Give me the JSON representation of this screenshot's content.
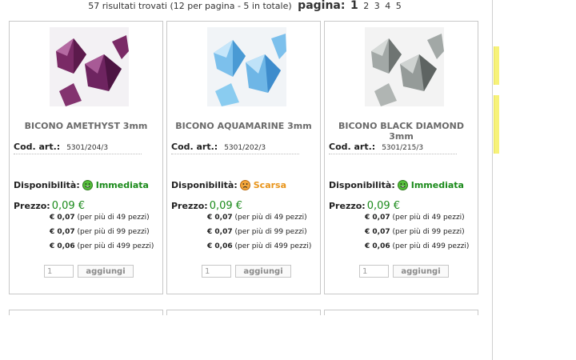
{
  "results": {
    "summary": "57 risultati trovati (12 per pagina - 5 in totale)",
    "page_label": "pagina:",
    "pages": [
      "1",
      "2",
      "3",
      "4",
      "5"
    ]
  },
  "labels": {
    "code": "Cod. art.:",
    "availability": "Disponibilità:",
    "price": "Prezzo:",
    "add_button": "aggiungi"
  },
  "products": [
    {
      "name": "BICONO AMETHYST 3mm",
      "code": "5301/204/3",
      "availability": "Immediata",
      "availability_color": "#1a8a1a",
      "availability_icon": "green-smiley-icon",
      "price": "0,09 €",
      "tiers": [
        {
          "price": "€ 0,07",
          "note": "(per più di 49 pezzi)"
        },
        {
          "price": "€ 0,07",
          "note": "(per più di 99 pezzi)"
        },
        {
          "price": "€ 0,06",
          "note": "(per più di 499 pezzi)"
        }
      ],
      "qty": "1",
      "bead_color": "#7a2a66"
    },
    {
      "name": "BICONO AQUAMARINE 3mm",
      "code": "5301/202/3",
      "availability": "Scarsa",
      "availability_color": "#e8941a",
      "availability_icon": "orange-smiley-icon",
      "price": "0,09 €",
      "tiers": [
        {
          "price": "€ 0,07",
          "note": "(per più di 49 pezzi)"
        },
        {
          "price": "€ 0,07",
          "note": "(per più di 99 pezzi)"
        },
        {
          "price": "€ 0,06",
          "note": "(per più di 499 pezzi)"
        }
      ],
      "qty": "1",
      "bead_color": "#5aa8de"
    },
    {
      "name": "BICONO BLACK DIAMOND 3mm",
      "code": "5301/215/3",
      "availability": "Immediata",
      "availability_color": "#1a8a1a",
      "availability_icon": "green-smiley-icon",
      "price": "0,09 €",
      "tiers": [
        {
          "price": "€ 0,07",
          "note": "(per più di 49 pezzi)"
        },
        {
          "price": "€ 0,07",
          "note": "(per più di 99 pezzi)"
        },
        {
          "price": "€ 0,06",
          "note": "(per più di 499 pezzi)"
        }
      ],
      "qty": "1",
      "bead_color": "#8a8f8e"
    }
  ]
}
